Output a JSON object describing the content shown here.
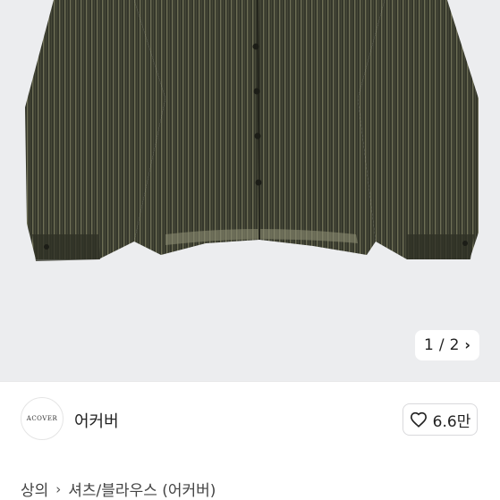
{
  "gallery": {
    "current_page": "1",
    "separator": "/",
    "total_pages": "2"
  },
  "shop": {
    "logo_text": "ACOVER",
    "name": "어커버",
    "like_count": "6.6만"
  },
  "breadcrumb": {
    "category": "상의",
    "subcategory": "셔츠/블라우스 (어커버)"
  },
  "colors": {
    "image_background": "#ecedef",
    "garment": "#3a3c30"
  },
  "icons": {
    "next": "chevron-right-icon",
    "like": "heart-outline-icon",
    "breadcrumb_sep": "chevron-right-icon"
  }
}
